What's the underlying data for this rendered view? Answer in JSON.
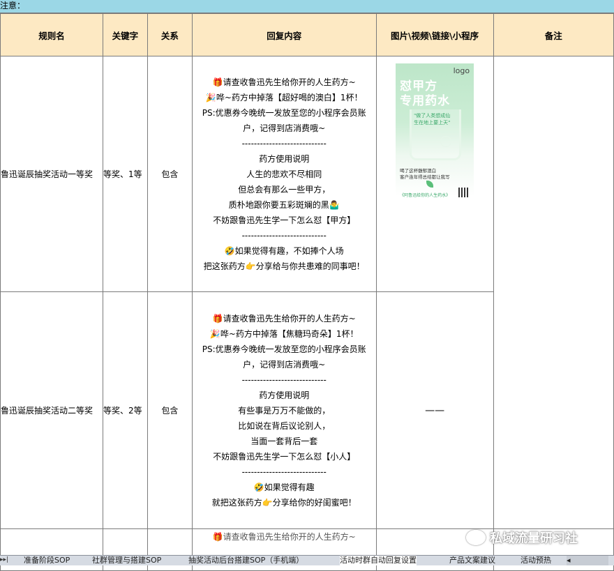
{
  "notice": "注意：",
  "headers": [
    "规则名",
    "关键字",
    "关系",
    "回复内容",
    "图片\\视频\\链接\\小程序",
    "备注"
  ],
  "rows": [
    {
      "rule_name": "鲁迅诞辰抽奖活动一等奖",
      "keyword": "等奖、1等",
      "relation": "包含",
      "reply": [
        "🎁请查收鲁迅先生给你开的人生药方~",
        "🎉哗~药方中掉落【超好喝的澳白】1杯！",
        "PS:优惠券今晚统一发放至您的小程序会员账",
        "户，记得到店消费哦~",
        "----------------------------",
        "药方使用说明",
        "人生的悲欢不尽相同",
        "但总会有那么一些甲方，",
        "质朴地跟你要五彩斑斓的黑🤷‍♂️",
        "不妨跟鲁迅先生学一下怎么怼【甲方】",
        "----------------------------",
        "🤣如果觉得有趣，不如捧个人场",
        "把这张药方👉分享给与你共患难的同事吧！"
      ],
      "media": {
        "logo": "logo",
        "title_line1": "怼甲方",
        "title_line2": "专用药水",
        "quote_line1": "\"做了人类想成仙",
        "quote_line2": "生在地上要上天\"",
        "sub_line1": "喝了这杯馥郁澳白",
        "sub_line2": "客户连年得总结都让我写",
        "footer": "《阿鲁迅给你的人生药水》"
      },
      "note": ""
    },
    {
      "rule_name": "鲁迅诞辰抽奖活动二等奖",
      "keyword": "等奖、2等",
      "relation": "包含",
      "reply": [
        "🎁请查收鲁迅先生给你开的人生药方~",
        "🎉哗~药方中掉落【焦糖玛奇朵】1杯！",
        "PS:优惠券今晚统一发放至您的小程序会员账",
        "户，记得到店消费哦~",
        "----------------------------",
        "药方使用说明",
        "有些事是万万不能做的，",
        "比如说在背后议论别人，",
        "当面一套背后一套",
        "不妨跟鲁迅先生学一下怎么怼【小人】",
        "----------------------------",
        "🤣如果觉得有趣",
        "就把这张药方👉分享给你的好闺蜜吧！"
      ],
      "media_text": "——",
      "note": ""
    }
  ],
  "partial_row_text": "🎁请查收鲁迅先生给你开的人生药方~",
  "sheet_tabs": [
    "准备阶段SOP",
    "社群管理与搭建SOP",
    "抽奖活动后台搭建SOP（手机端）",
    "活动时群自动回复设置",
    "产品文案建议",
    "活动预热"
  ],
  "active_tab": 3,
  "watermark": "私域流量研习社"
}
